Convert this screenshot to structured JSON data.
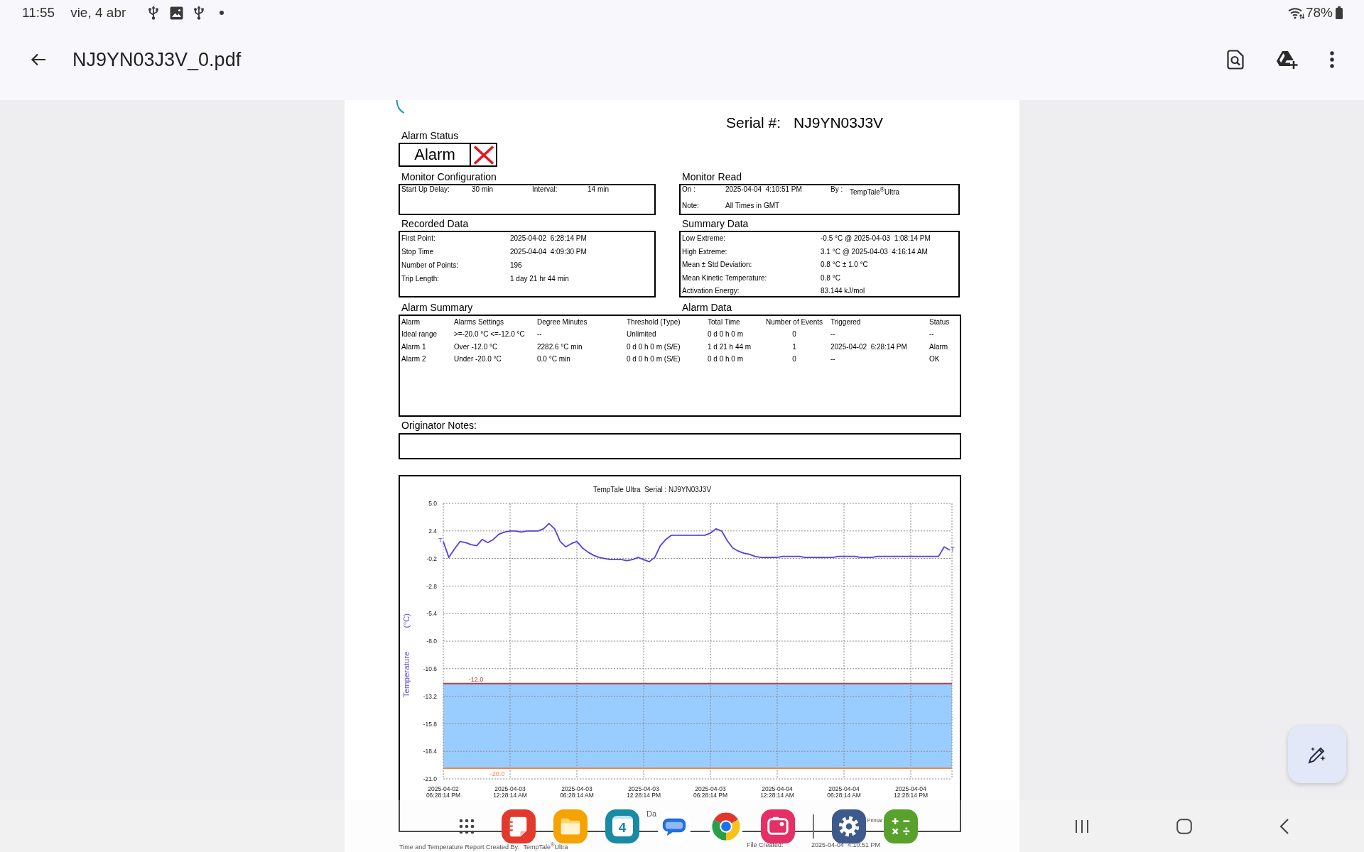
{
  "status_bar": {
    "time": "11:55",
    "date": "vie, 4 abr",
    "battery": "78%"
  },
  "app_bar": {
    "title": "NJ9YN03J3V_0.pdf"
  },
  "document": {
    "serial": {
      "label": "Serial #:",
      "value": "NJ9YN03J3V"
    },
    "alarm_status": {
      "heading": "Alarm Status",
      "value": "Alarm",
      "alarm": true
    },
    "monitor_configuration": {
      "heading": "Monitor Configuration",
      "rows": [
        [
          "Start Up Delay:",
          "30 min",
          "Interval:",
          "14 min"
        ]
      ]
    },
    "monitor_read": {
      "heading": "Monitor Read",
      "rows": [
        [
          "On :",
          "2025-04-04  4:10:51 PM",
          "By :",
          "TempTale$^{®}$Ultra"
        ],
        [
          "Note:",
          "All Times in GMT"
        ]
      ]
    },
    "recorded_data": {
      "heading": "Recorded Data",
      "rows": [
        [
          "First Point:",
          "2025-04-02  6:28:14 PM"
        ],
        [
          "Stop Time",
          "2025-04-04  4:09:30 PM"
        ],
        [
          "Number of Points:",
          "196"
        ],
        [
          "Trip Length:",
          "1 day 21 hr 44 min"
        ]
      ]
    },
    "summary_data": {
      "heading": "Summary Data",
      "rows": [
        [
          "Low Extreme:",
          "-0.5 °C @ 2025-04-03  1:08:14 PM"
        ],
        [
          "High Extreme:",
          "3.1 °C @ 2025-04-03  4:16:14 AM"
        ],
        [
          "Mean ± Std Deviation:",
          "0.8 °C ± 1.0 °C"
        ],
        [
          "Mean Kinetic Temperature:",
          "0.8 °C"
        ],
        [
          "Activation Energy:",
          "83.144 kJ/mol"
        ]
      ]
    },
    "alarm_summary": {
      "heading": "Alarm Summary",
      "columns": [
        "Alarm",
        "Alarms Settings",
        "Degree Minutes",
        "Threshold (Type)",
        "Total Time",
        "Number of Events",
        "Triggered",
        "Status"
      ],
      "rows": [
        [
          "Ideal range",
          ">=-20.0 °C <=-12.0 °C",
          "--",
          "Unlimited",
          "0 d 0 h 0 m",
          "0",
          "--",
          "--"
        ],
        [
          "Alarm 1",
          "Over -12.0 °C",
          "2282.6 °C min",
          "0 d 0 h 0 m (S/E)",
          "1 d 21 h 44 m",
          "1",
          "2025-04-02  6:28:14 PM",
          "Alarm"
        ],
        [
          "Alarm 2",
          "Under -20.0 °C",
          "0.0 °C min",
          "0 d 0 h 0 m (S/E)",
          "0 d 0 h 0 m",
          "0",
          "--",
          "OK"
        ]
      ]
    },
    "alarm_data": {
      "heading": "Alarm Data"
    },
    "originator_notes": {
      "heading": "Originator Notes:"
    },
    "chart": {
      "chart_data": {
        "type": "line",
        "title": "TempTale Ultra  Serial : NJ9YN03J3V",
        "xlabel": "Da",
        "ylabel": "Temperature (°C)",
        "grid": true,
        "categories": [
          "2025-04-02 06:28:14 PM",
          null,
          null,
          null,
          null,
          null,
          null,
          null,
          null,
          null,
          null,
          null,
          "2025-04-03 12:28:14 AM",
          null,
          null,
          null,
          null,
          null,
          null,
          null,
          null,
          null,
          null,
          null,
          "2025-04-03 06:28:14 AM",
          null,
          null,
          null,
          null,
          null,
          null,
          null,
          null,
          null,
          null,
          null,
          "2025-04-03 12:28:14 PM",
          null,
          null,
          null,
          null,
          null,
          null,
          null,
          null,
          null,
          null,
          null,
          "2025-04-03 06:28:14 PM",
          null,
          null,
          null,
          null,
          null,
          null,
          null,
          null,
          null,
          null,
          null,
          "2025-04-04 12:28:14 AM",
          null,
          null,
          null,
          null,
          null,
          null,
          null,
          null,
          null,
          null,
          null,
          "2025-04-04 06:28:14 AM",
          null,
          null,
          null,
          null,
          null,
          null,
          null,
          null,
          null,
          null,
          null,
          "2025-04-04 12:28:14 PM",
          null,
          null,
          null,
          null,
          null,
          null,
          null
        ],
        "series": [
          {
            "color": "#5a3ce0",
            "values": [
              1.4,
              -0.1,
              0.7,
              1.4,
              1.3,
              1.1,
              1.0,
              1.6,
              1.3,
              1.6,
              2.1,
              2.3,
              2.4,
              2.4,
              2.3,
              2.4,
              2.4,
              2.4,
              2.6,
              3.1,
              2.6,
              1.4,
              0.9,
              1.2,
              1.4,
              0.8,
              0.4,
              0.1,
              -0.1,
              -0.2,
              -0.3,
              -0.3,
              -0.3,
              -0.4,
              -0.3,
              -0.1,
              -0.3,
              -0.5,
              -0.1,
              1.0,
              1.6,
              2.0,
              2.0,
              2.0,
              2.0,
              2.0,
              2.0,
              2.0,
              2.2,
              2.6,
              2.4,
              1.5,
              0.8,
              0.5,
              0.3,
              0.2,
              0.0,
              -0.1,
              -0.1,
              -0.1,
              -0.1,
              0.0,
              0.0,
              0.0,
              0.0,
              -0.1,
              -0.1,
              -0.1,
              -0.1,
              -0.1,
              -0.1,
              0.0,
              0.0,
              0.0,
              0.0,
              -0.1,
              -0.1,
              -0.1,
              0.0,
              0.0,
              0.0,
              0.0,
              0.0,
              0.0,
              0.0,
              0.0,
              0.0,
              0.0,
              0.0,
              0.0,
              0.9,
              0.6
            ]
          }
        ],
        "ylim": [
          -21,
          5
        ],
        "yticks": [
          {
            "value": 5,
            "label": "5.0"
          },
          {
            "value": 2.4,
            "label": "2.4"
          },
          {
            "value": -0.2,
            "label": "-0.2"
          },
          {
            "value": -2.8,
            "label": "-2.8"
          },
          {
            "value": -5.4,
            "label": "-5.4"
          },
          {
            "value": -8,
            "label": "-8.0"
          },
          {
            "value": -10.6,
            "label": "-10.6"
          },
          {
            "value": -13.2,
            "label": "-13.2"
          },
          {
            "value": -15.8,
            "label": "-15.8"
          },
          {
            "value": -18.4,
            "label": "-18.4"
          },
          {
            "value": -21,
            "label": "-21.0"
          }
        ],
        "bands": [
          {
            "axis": "y",
            "from": -20,
            "to": -12,
            "color": "#99ccff"
          }
        ],
        "ref_lines": [
          {
            "axis": "y",
            "value": -12,
            "label": "-12.0",
            "color": "#b5404a"
          },
          {
            "axis": "y",
            "value": -20,
            "label": "-20.0",
            "color": "#e8894a"
          }
        ],
        "annotations": [
          "T",
          "T"
        ]
      },
      "legend_fragment": "Primar"
    },
    "footer": {
      "created_by": "Time and Temperature Report Created By:  TempTale$^{®}$Ultra",
      "file_created_label": "File Created:",
      "file_created": "2025-04-04  4:10:51 PM"
    }
  },
  "dock": {
    "apps": [
      {
        "kind": "apps"
      },
      {
        "kind": "notes"
      },
      {
        "kind": "folder"
      },
      {
        "kind": "calendar",
        "day": "4"
      },
      {
        "kind": "messages"
      },
      {
        "kind": "browser"
      },
      {
        "kind": "camera"
      },
      {
        "kind": "divider"
      },
      {
        "kind": "settings"
      },
      {
        "kind": "calculator"
      }
    ]
  }
}
